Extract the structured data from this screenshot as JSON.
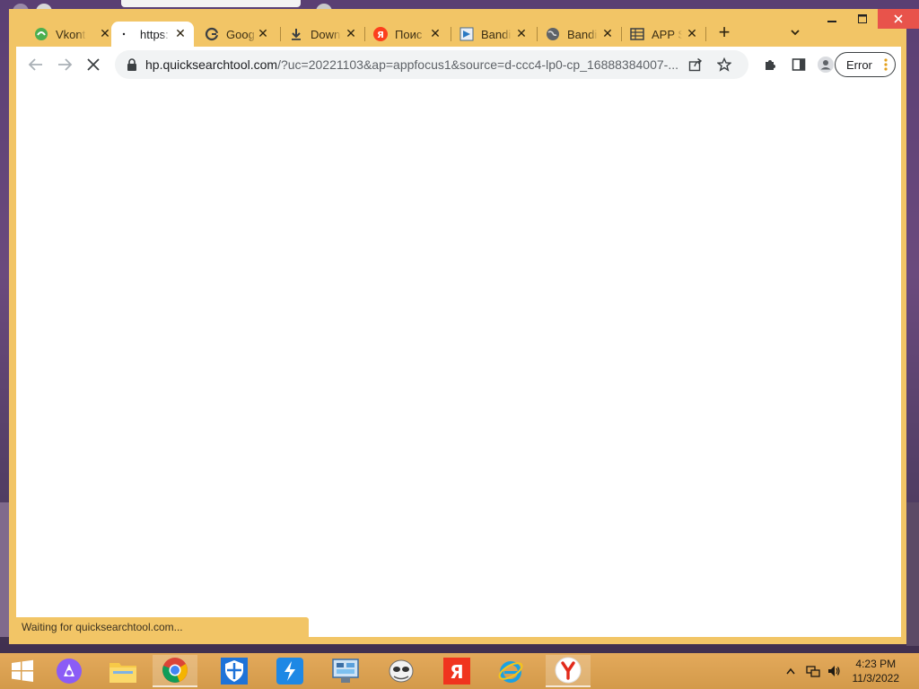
{
  "browser": {
    "tabs": [
      {
        "title": "Vkont",
        "icon": "vk-leaf-icon",
        "active": false
      },
      {
        "title": "https:",
        "icon": "loading-dot-icon",
        "active": true
      },
      {
        "title": "Goog",
        "icon": "google-icon",
        "active": false
      },
      {
        "title": "Down",
        "icon": "download-icon",
        "active": false
      },
      {
        "title": "Поис",
        "icon": "yandex-icon",
        "active": false
      },
      {
        "title": "Bandi",
        "icon": "bandicam-icon",
        "active": false
      },
      {
        "title": "Bandi",
        "icon": "globe-icon",
        "active": false
      },
      {
        "title": "APP S",
        "icon": "table-icon",
        "active": false
      }
    ],
    "new_tab_label": "+",
    "url_host": "hp.quicksearchtool.com",
    "url_rest": "/?uc=20221103&ap=appfocus1&source=d-ccc4-lp0-cp_16888384007-...",
    "error_chip_label": "Error",
    "status_text": "Waiting for quicksearchtool.com...",
    "colors": {
      "frame": "#f2c566",
      "close": "#e8534b"
    }
  },
  "taskbar": {
    "items": [
      {
        "name": "start-button",
        "icon": "windows-logo-icon"
      },
      {
        "name": "alice-app",
        "icon": "alice-icon"
      },
      {
        "name": "file-explorer",
        "icon": "folder-icon"
      },
      {
        "name": "chrome-app",
        "icon": "chrome-icon"
      },
      {
        "name": "defender-app",
        "icon": "shield-icon"
      },
      {
        "name": "transfer-app",
        "icon": "bolt-icon"
      },
      {
        "name": "control-panel",
        "icon": "control-panel-icon"
      },
      {
        "name": "mascot-app",
        "icon": "ghost-icon"
      },
      {
        "name": "yandex-browser-red",
        "icon": "yandex-letter-icon"
      },
      {
        "name": "internet-explorer",
        "icon": "ie-icon"
      },
      {
        "name": "yandex-browser",
        "icon": "yandex-y-icon"
      }
    ],
    "time": "4:23 PM",
    "date": "11/3/2022"
  }
}
